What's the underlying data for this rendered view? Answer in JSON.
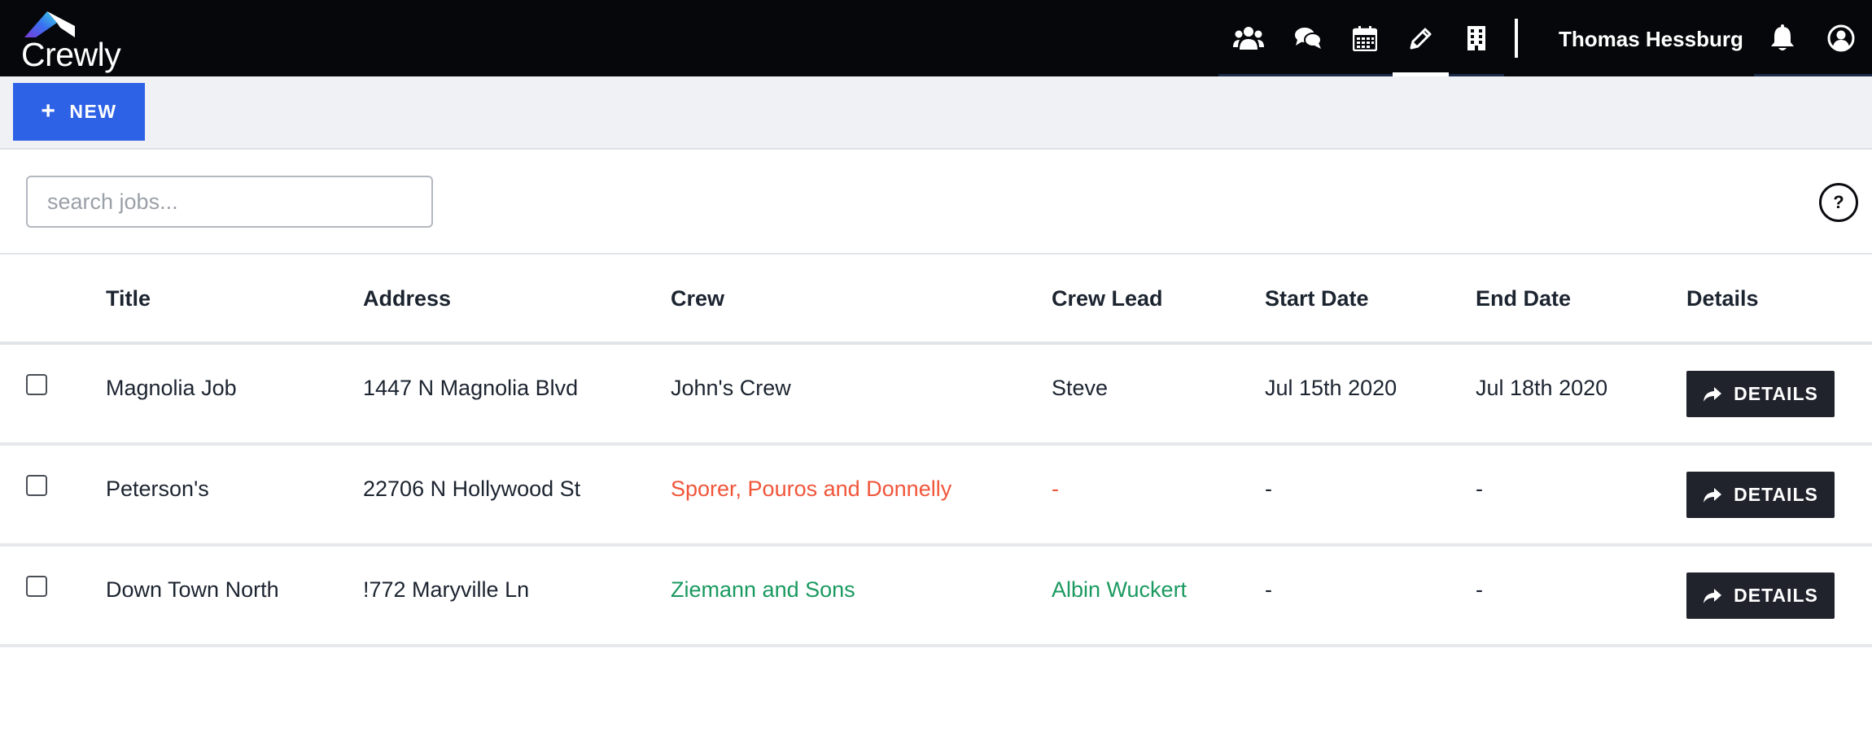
{
  "app": {
    "logo_text": "Crewly"
  },
  "nav": {
    "icons": [
      {
        "name": "users-icon",
        "active": false
      },
      {
        "name": "comments-icon",
        "active": false
      },
      {
        "name": "calendar-icon",
        "active": false
      },
      {
        "name": "pencil-icon",
        "active": true
      },
      {
        "name": "building-icon",
        "active": false
      }
    ],
    "user_name": "Thomas Hessburg",
    "right_icons": [
      "bell-icon",
      "user-circle-icon"
    ]
  },
  "toolbar": {
    "new_label": "NEW"
  },
  "search": {
    "placeholder": "search jobs...",
    "value": ""
  },
  "help_label": "?",
  "table": {
    "columns": [
      "Title",
      "Address",
      "Crew",
      "Crew Lead",
      "Start Date",
      "End Date",
      "Details"
    ],
    "details_label": "DETAILS",
    "rows": [
      {
        "title": "Magnolia Job",
        "address": "1447 N Magnolia Blvd",
        "crew": "John's Crew",
        "crew_lead": "Steve",
        "start": "Jul 15th 2020",
        "end": "Jul 18th 2020",
        "crew_color": "#1c2430"
      },
      {
        "title": "Peterson's",
        "address": "22706 N Hollywood St",
        "crew": "Sporer, Pouros and Donnelly",
        "crew_lead": "-",
        "start": "-",
        "end": "-",
        "crew_color": "#f0553a"
      },
      {
        "title": "Down Town North",
        "address": "!772 Maryville Ln",
        "crew": "Ziemann and Sons",
        "crew_lead": "Albin Wuckert",
        "start": "-",
        "end": "-",
        "crew_color": "#1a9960"
      }
    ]
  },
  "colors": {
    "topbar": "#06070a",
    "accent_blue": "#2e62e6",
    "nav_underline": "#1a2a4a",
    "nav_active": "#ffffff",
    "details_button": "#20232c"
  }
}
